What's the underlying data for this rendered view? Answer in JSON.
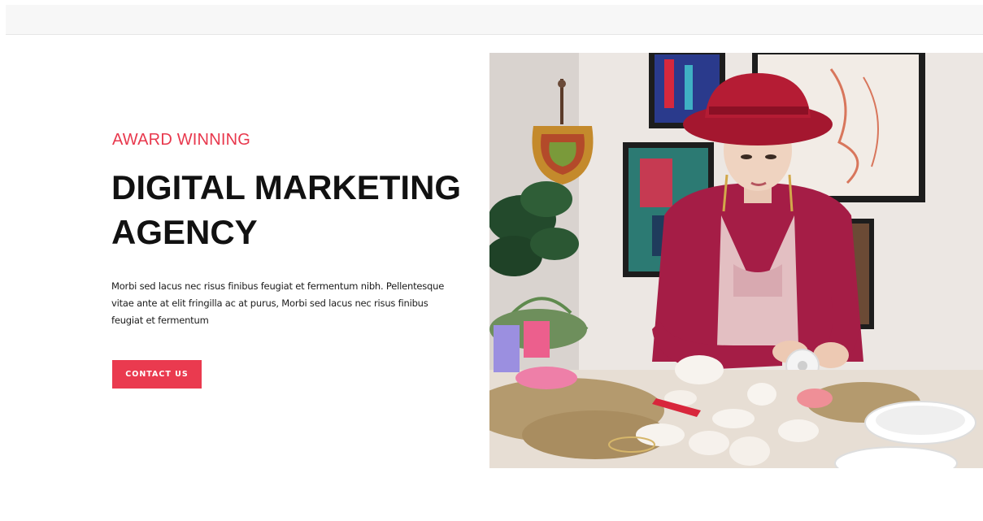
{
  "hero": {
    "eyebrow": "AWARD WINNING",
    "headline_line1": "DIGITAL MARKETING",
    "headline_line2": "AGENCY",
    "body": "Morbi sed lacus nec risus finibus feugiat et fermentum nibh. Pellentesque vitae ante at elit fringilla ac at purus, Morbi sed lacus nec risus finibus feugiat et fermentum",
    "cta_label": "CONTACT US"
  },
  "colors": {
    "accent": "#ea3a4f",
    "headline": "#111111",
    "topbar": "#f7f7f7"
  },
  "image": {
    "subject": "woman-crafting-photo"
  }
}
